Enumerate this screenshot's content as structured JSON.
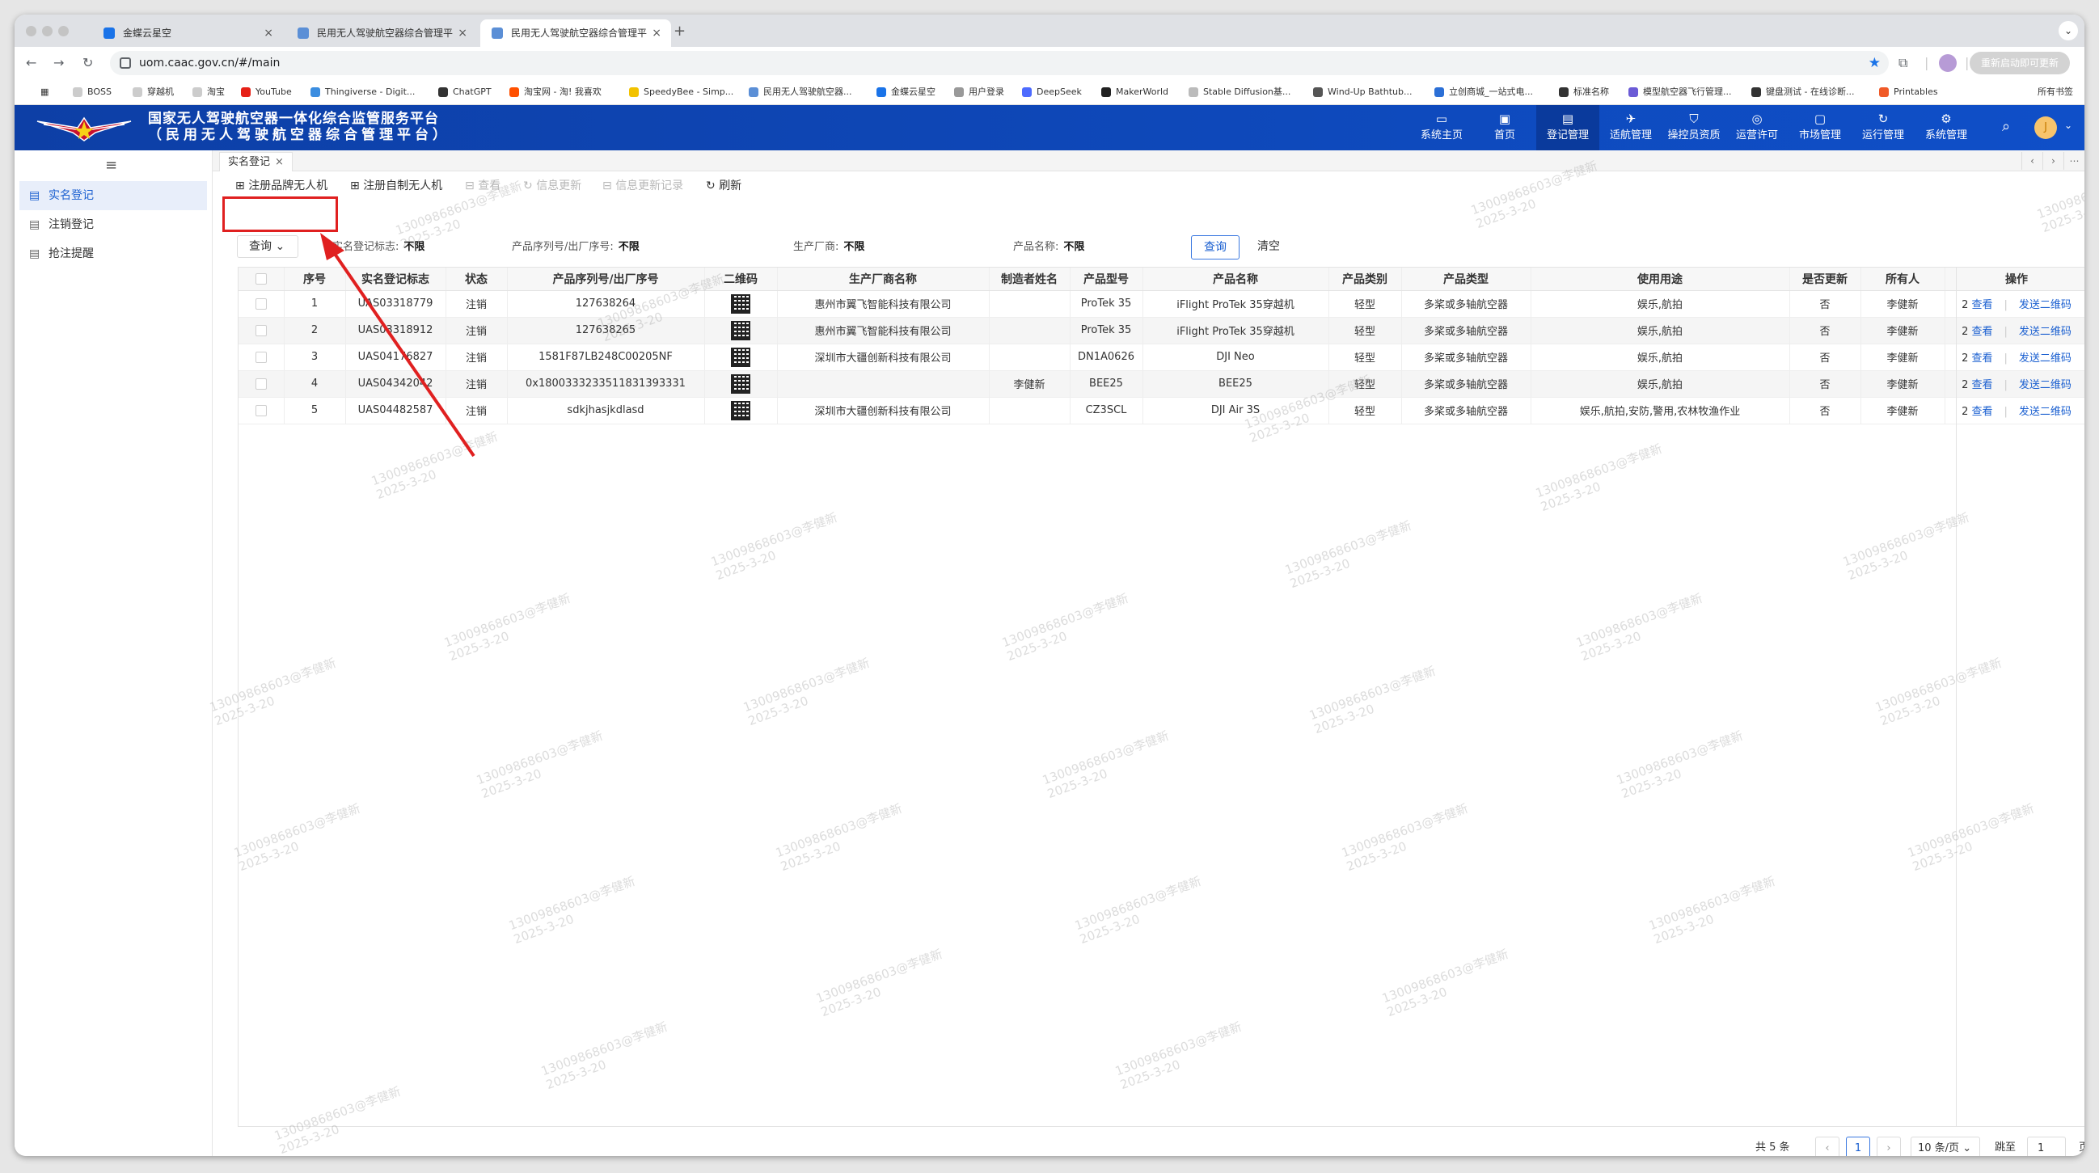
{
  "browser": {
    "tabs": [
      {
        "title": "金蝶云星空"
      },
      {
        "title": "民用无人驾驶航空器综合管理平"
      },
      {
        "title": "民用无人驾驶航空器综合管理平"
      }
    ],
    "new_tab": "+",
    "url": "uom.caac.gov.cn/#/main",
    "update_button": "重新启动即可更新",
    "bookmarks": [
      "BOSS",
      "穿越机",
      "淘宝",
      "YouTube",
      "Thingiverse - Digit...",
      "ChatGPT",
      "淘宝网 - 淘! 我喜欢",
      "SpeedyBee - Simp...",
      "民用无人驾驶航空器...",
      "金蝶云星空",
      "用户登录",
      "DeepSeek",
      "MakerWorld",
      "Stable Diffusion基...",
      "Wind-Up Bathtub...",
      "立创商城_一站式电...",
      "标准名称",
      "模型航空器飞行管理...",
      "键盘测试 - 在线诊断...",
      "Printables"
    ],
    "all_bookmarks": "所有书签"
  },
  "app": {
    "title_line1": "国家无人驾驶航空器一体化综合监管服务平台",
    "title_line2": "（民用无人驾驶航空器综合管理平台）",
    "nav": [
      {
        "label": "系统主页",
        "icon": "dashboard-icon"
      },
      {
        "label": "首页",
        "icon": "monitor-icon"
      },
      {
        "label": "登记管理",
        "icon": "register-icon"
      },
      {
        "label": "适航管理",
        "icon": "drone-icon"
      },
      {
        "label": "操控员资质",
        "icon": "shield-icon"
      },
      {
        "label": "运营许可",
        "icon": "license-icon"
      },
      {
        "label": "市场管理",
        "icon": "market-icon"
      },
      {
        "label": "运行管理",
        "icon": "refresh-icon"
      },
      {
        "label": "系统管理",
        "icon": "gear-icon"
      }
    ],
    "avatar_letter": "J"
  },
  "sidebar": {
    "items": [
      {
        "label": "实名登记",
        "active": true
      },
      {
        "label": "注销登记",
        "active": false
      },
      {
        "label": "抢注提醒",
        "active": false
      }
    ]
  },
  "page_tab": {
    "label": "实名登记",
    "close": "×"
  },
  "actions": {
    "register_brand": "注册品牌无人机",
    "register_custom": "注册自制无人机",
    "view": "查看",
    "info_update": "信息更新",
    "info_update_log": "信息更新记录",
    "refresh": "刷新"
  },
  "filter": {
    "query_select": "查询",
    "realname_flag_label": "实名登记标志:",
    "realname_flag_value": "不限",
    "serial_label": "产品序列号/出厂序号:",
    "serial_value": "不限",
    "maker_label": "生产厂商:",
    "maker_value": "不限",
    "product_label": "产品名称:",
    "product_value": "不限",
    "query_button": "查询",
    "clear_button": "清空"
  },
  "table": {
    "headers": [
      "",
      "序号",
      "实名登记标志",
      "状态",
      "产品序列号/出厂序号",
      "二维码",
      "生产厂商名称",
      "制造者姓名",
      "产品型号",
      "产品名称",
      "产品类别",
      "产品类型",
      "使用用途",
      "是否更新",
      "所有人",
      "操作"
    ],
    "rows": [
      {
        "no": "1",
        "uas": "UAS03318779",
        "status": "注销",
        "serial": "127638264",
        "maker": "惠州市翼飞智能科技有限公司",
        "builder": "",
        "model": "ProTek 35",
        "name": "iFlight ProTek 35穿越机",
        "category": "轻型",
        "type": "多桨或多轴航空器",
        "usage": "娱乐,航拍",
        "updated": "否",
        "owner": "李健新",
        "count": "2"
      },
      {
        "no": "2",
        "uas": "UAS03318912",
        "status": "注销",
        "serial": "127638265",
        "maker": "惠州市翼飞智能科技有限公司",
        "builder": "",
        "model": "ProTek 35",
        "name": "iFlight ProTek 35穿越机",
        "category": "轻型",
        "type": "多桨或多轴航空器",
        "usage": "娱乐,航拍",
        "updated": "否",
        "owner": "李健新",
        "count": "2"
      },
      {
        "no": "3",
        "uas": "UAS04176827",
        "status": "注销",
        "serial": "1581F87LB248C00205NF",
        "maker": "深圳市大疆创新科技有限公司",
        "builder": "",
        "model": "DN1A0626",
        "name": "DJI Neo",
        "category": "轻型",
        "type": "多桨或多轴航空器",
        "usage": "娱乐,航拍",
        "updated": "否",
        "owner": "李健新",
        "count": "2"
      },
      {
        "no": "4",
        "uas": "UAS04342042",
        "status": "注销",
        "serial": "0x1800333233511831393331",
        "maker": "",
        "builder": "李健新",
        "model": "BEE25",
        "name": "BEE25",
        "category": "轻型",
        "type": "多桨或多轴航空器",
        "usage": "娱乐,航拍",
        "updated": "否",
        "owner": "李健新",
        "count": "2"
      },
      {
        "no": "5",
        "uas": "UAS04482587",
        "status": "注销",
        "serial": "sdkjhasjkdlasd",
        "maker": "深圳市大疆创新科技有限公司",
        "builder": "",
        "model": "CZ3SCL",
        "name": "DJI Air 3S",
        "category": "轻型",
        "type": "多桨或多轴航空器",
        "usage": "娱乐,航拍,安防,警用,农林牧渔作业",
        "updated": "否",
        "owner": "李健新",
        "count": "2"
      }
    ],
    "op_view": "查看",
    "op_send_qr": "发送二维码"
  },
  "pager": {
    "total": "共 5 条",
    "prev": "‹",
    "current": "1",
    "next": "›",
    "page_size": "10 条/页",
    "jump_label": "跳至",
    "jump_value": "1",
    "page_suffix": "页"
  },
  "watermark": {
    "line1": "13009868603@李健新",
    "line2": "2025-3-20"
  },
  "colors": {
    "header_blue": "#0f4fc8",
    "link_blue": "#1a5fd0",
    "annotation_red": "#e02020"
  }
}
